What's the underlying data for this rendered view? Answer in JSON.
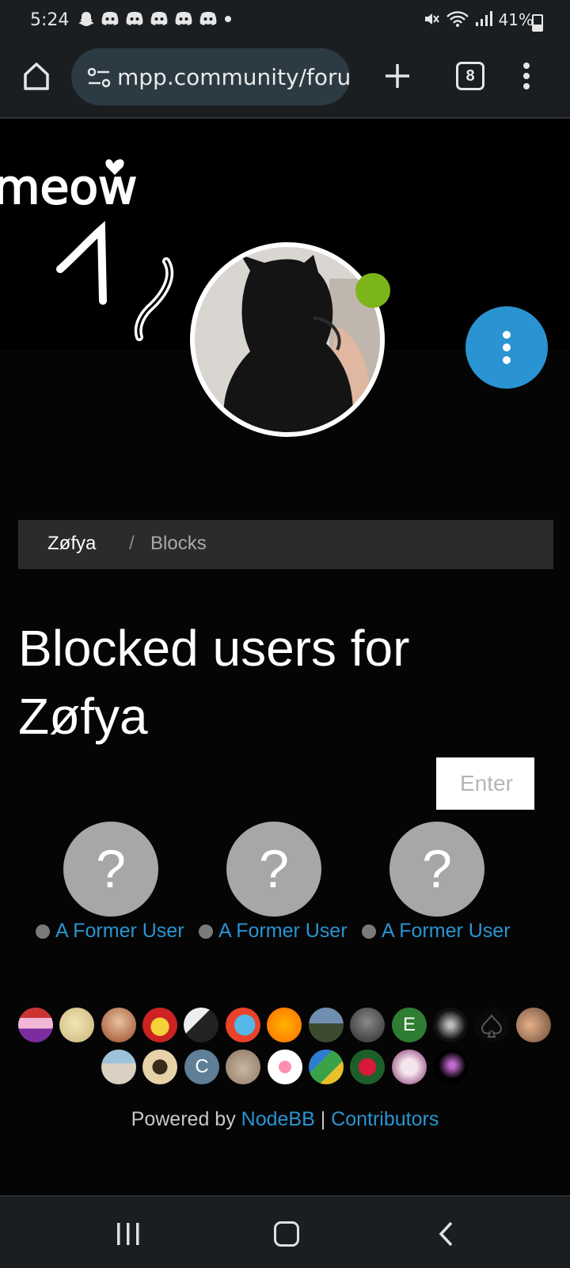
{
  "status_bar": {
    "time": "5:24",
    "notifications": [
      "snapchat-icon",
      "discord-icon",
      "discord-icon",
      "discord-icon",
      "discord-icon",
      "discord-icon",
      "dot-icon"
    ],
    "battery": "41%",
    "battery_level": 0.41
  },
  "browser": {
    "url": "mpp.community/foru",
    "tab_count": "8"
  },
  "profile": {
    "cover_text": "meow",
    "online": true,
    "status_color": "#7cb51a"
  },
  "breadcrumb": {
    "user": "Zøfya",
    "separator": "/",
    "current": "Blocks"
  },
  "page": {
    "title": "Blocked users for Zøfya",
    "search_placeholder": "Enter"
  },
  "blocked_users": [
    {
      "avatar_letter": "?",
      "name": "A Former User"
    },
    {
      "avatar_letter": "?",
      "name": "A Former User"
    },
    {
      "avatar_letter": "?",
      "name": "A Former User"
    }
  ],
  "contributors": {
    "letters": [
      "E",
      "C"
    ]
  },
  "footer": {
    "powered_by": "Powered by ",
    "nodebb": "NodeBB",
    "separator": " | ",
    "contributors": "Contributors"
  },
  "colors": {
    "accent": "#2a94d2",
    "background": "#050505",
    "breadcrumb_bg": "#2b2b2b"
  }
}
